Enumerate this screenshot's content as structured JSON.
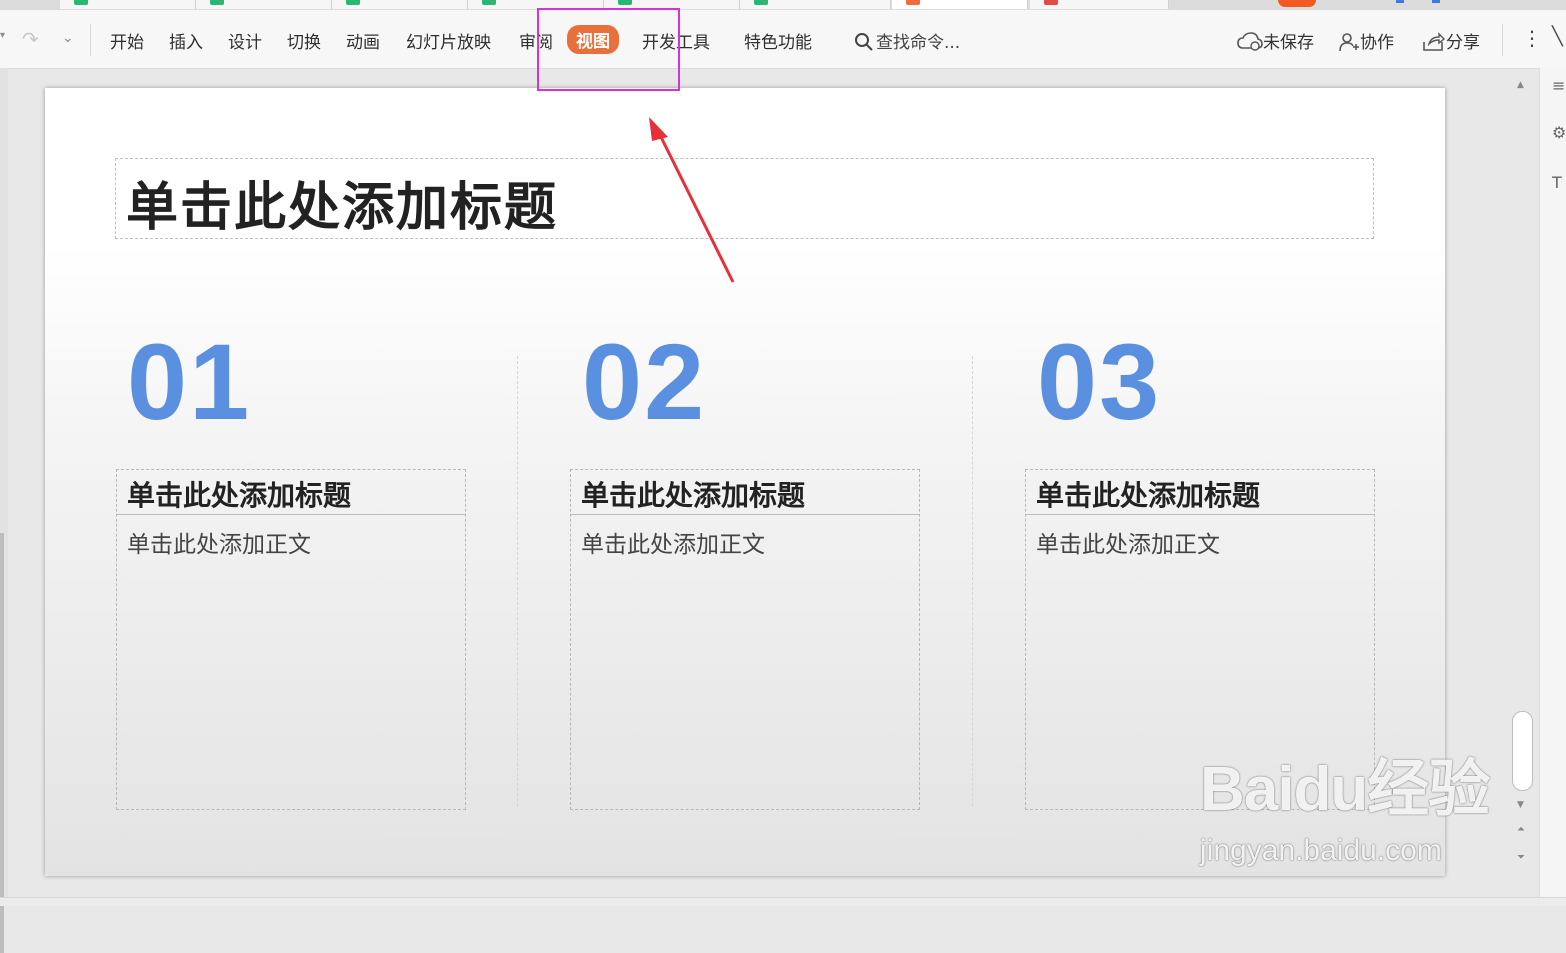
{
  "toolbar": {
    "menus": [
      "开始",
      "插入",
      "设计",
      "切换",
      "动画",
      "幻灯片放映",
      "审阅",
      "视图",
      "开发工具",
      "特色功能"
    ],
    "active_menu": "视图",
    "search_label": "查找命令...",
    "right": {
      "save": "未保存",
      "collab": "协作",
      "share": "分享"
    }
  },
  "slide": {
    "title": "单击此处添加标题",
    "columns": [
      {
        "number": "01",
        "heading": "单击此处添加标题",
        "body": "单击此处添加正文"
      },
      {
        "number": "02",
        "heading": "单击此处添加标题",
        "body": "单击此处添加正文"
      },
      {
        "number": "03",
        "heading": "单击此处添加标题",
        "body": "单击此处添加正文"
      }
    ]
  },
  "watermark": {
    "brand": "Baidu经验",
    "site": "jingyan.baidu.com"
  },
  "colors": {
    "accent_active": "#e8703a",
    "number_blue": "#5b8fe0",
    "highlight_box": "#d633d6",
    "arrow": "#e8303a"
  }
}
